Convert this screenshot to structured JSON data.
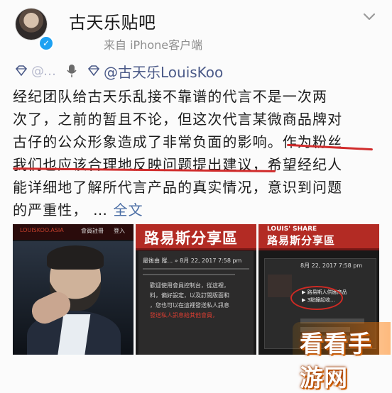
{
  "account": {
    "name": "古天乐贴吧",
    "source": "来自 iPhone客户端"
  },
  "post": {
    "mention": "@古天乐LouisKoo",
    "blurred_user": "@…",
    "lines": [
      "经纪团队给古天乐乱接不靠谱的代言不是一次两",
      "次了，之前的暂且不论，但这次代言某微商品牌对",
      "古仔的公众形象造成了非常负面的影响。作为粉丝",
      "我们也应该合理地反映问题提出建议，希望经纪人",
      "能详细地了解所代言产品的真实情况，意识到问题",
      "的严重性，"
    ],
    "more_dots": "…",
    "more_label": "全文"
  },
  "images": {
    "thumb1": {
      "brand": "LOUISKOO.ASIA",
      "members": "會員註冊",
      "login": "登入"
    },
    "thumb2": {
      "banner": "路易斯分享區",
      "meta": "最後由 蹤... » 8月 22, 2017 7:58 pm",
      "text": [
        "歡迎使用會員控制台，從這裡，",
        "料，偏好設定，以及訂閱版面和",
        "，您也可以在這裡發送私人訊息",
        "發送私人訊息給其他會員，"
      ]
    },
    "thumb3": {
      "sub": "LOUIS' SHARE",
      "banner": "路易斯分享區",
      "meta": "8月 22, 2017 7:58 pm",
      "text": [
        "▶ 路易斯人供應商品",
        "▶ 3點鐘起收..."
      ]
    }
  },
  "watermark": "看看手游网",
  "colors": {
    "link": "#4b6ea5",
    "underline": "#d12c2c",
    "verified": "#1da1f2"
  }
}
